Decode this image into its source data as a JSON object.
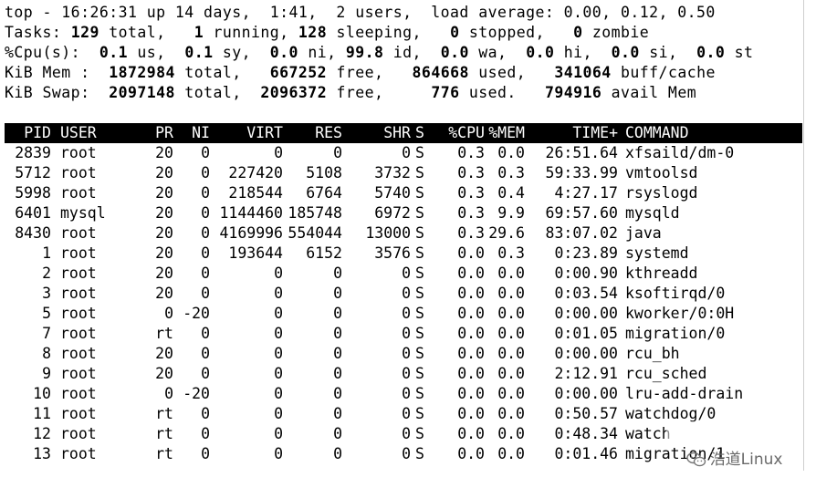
{
  "summary": {
    "line1": "top - 16:26:31 up 14 days,  1:41,  2 users,  load average: 0.00, 0.12, 0.50",
    "tasks": {
      "label": "Tasks: ",
      "total": "129",
      "total_label": " total,   ",
      "running": "1",
      "running_label": " running, ",
      "sleeping": "128",
      "sleeping_label": " sleeping,   ",
      "stopped": "0",
      "stopped_label": " stopped,   ",
      "zombie": "0",
      "zombie_label": " zombie"
    },
    "cpu": {
      "label": "%Cpu(s):  ",
      "us": "0.1",
      "us_label": " us,  ",
      "sy": "0.1",
      "sy_label": " sy,  ",
      "ni": "0.0",
      "ni_label": " ni, ",
      "id": "99.8",
      "id_label": " id,  ",
      "wa": "0.0",
      "wa_label": " wa,  ",
      "hi": "0.0",
      "hi_label": " hi,  ",
      "si": "0.0",
      "si_label": " si,  ",
      "st": "0.0",
      "st_label": " st"
    },
    "mem": {
      "label": "KiB Mem :  ",
      "total": "1872984",
      "total_label": " total,   ",
      "free": "667252",
      "free_label": " free,   ",
      "used": "864668",
      "used_label": " used,   ",
      "buff": "341064",
      "buff_label": " buff/cache"
    },
    "swap": {
      "label": "KiB Swap:  ",
      "total": "2097148",
      "total_label": " total,  ",
      "free": "2096372",
      "free_label": " free,     ",
      "used": "776",
      "used_label": " used.   ",
      "avail": "794916",
      "avail_label": " avail Mem"
    }
  },
  "table": {
    "headers": {
      "pid": "PID",
      "user": "USER",
      "pr": "PR",
      "ni": "NI",
      "virt": "VIRT",
      "res": "RES",
      "shr": "SHR",
      "s": "S",
      "cpu": "%CPU",
      "mem": "%MEM",
      "time": "TIME+",
      "cmd": "COMMAND"
    },
    "rows": [
      {
        "pid": "2839",
        "user": "root",
        "pr": "20",
        "ni": "0",
        "virt": "0",
        "res": "0",
        "shr": "0",
        "s": "S",
        "cpu": "0.3",
        "mem": "0.0",
        "time": "26:51.64",
        "cmd": "xfsaild/dm-0"
      },
      {
        "pid": "5712",
        "user": "root",
        "pr": "20",
        "ni": "0",
        "virt": "227420",
        "res": "5108",
        "shr": "3732",
        "s": "S",
        "cpu": "0.3",
        "mem": "0.3",
        "time": "59:33.99",
        "cmd": "vmtoolsd"
      },
      {
        "pid": "5998",
        "user": "root",
        "pr": "20",
        "ni": "0",
        "virt": "218544",
        "res": "6764",
        "shr": "5740",
        "s": "S",
        "cpu": "0.3",
        "mem": "0.4",
        "time": "4:27.17",
        "cmd": "rsyslogd"
      },
      {
        "pid": "6401",
        "user": "mysql",
        "pr": "20",
        "ni": "0",
        "virt": "1144460",
        "res": "185748",
        "shr": "6972",
        "s": "S",
        "cpu": "0.3",
        "mem": "9.9",
        "time": "69:57.60",
        "cmd": "mysqld"
      },
      {
        "pid": "8430",
        "user": "root",
        "pr": "20",
        "ni": "0",
        "virt": "4169996",
        "res": "554044",
        "shr": "13000",
        "s": "S",
        "cpu": "0.3",
        "mem": "29.6",
        "time": "83:07.02",
        "cmd": "java"
      },
      {
        "pid": "1",
        "user": "root",
        "pr": "20",
        "ni": "0",
        "virt": "193644",
        "res": "6152",
        "shr": "3576",
        "s": "S",
        "cpu": "0.0",
        "mem": "0.3",
        "time": "0:23.89",
        "cmd": "systemd"
      },
      {
        "pid": "2",
        "user": "root",
        "pr": "20",
        "ni": "0",
        "virt": "0",
        "res": "0",
        "shr": "0",
        "s": "S",
        "cpu": "0.0",
        "mem": "0.0",
        "time": "0:00.90",
        "cmd": "kthreadd"
      },
      {
        "pid": "3",
        "user": "root",
        "pr": "20",
        "ni": "0",
        "virt": "0",
        "res": "0",
        "shr": "0",
        "s": "S",
        "cpu": "0.0",
        "mem": "0.0",
        "time": "0:03.54",
        "cmd": "ksoftirqd/0"
      },
      {
        "pid": "5",
        "user": "root",
        "pr": "0",
        "ni": "-20",
        "virt": "0",
        "res": "0",
        "shr": "0",
        "s": "S",
        "cpu": "0.0",
        "mem": "0.0",
        "time": "0:00.00",
        "cmd": "kworker/0:0H"
      },
      {
        "pid": "7",
        "user": "root",
        "pr": "rt",
        "ni": "0",
        "virt": "0",
        "res": "0",
        "shr": "0",
        "s": "S",
        "cpu": "0.0",
        "mem": "0.0",
        "time": "0:01.05",
        "cmd": "migration/0"
      },
      {
        "pid": "8",
        "user": "root",
        "pr": "20",
        "ni": "0",
        "virt": "0",
        "res": "0",
        "shr": "0",
        "s": "S",
        "cpu": "0.0",
        "mem": "0.0",
        "time": "0:00.00",
        "cmd": "rcu_bh"
      },
      {
        "pid": "9",
        "user": "root",
        "pr": "20",
        "ni": "0",
        "virt": "0",
        "res": "0",
        "shr": "0",
        "s": "S",
        "cpu": "0.0",
        "mem": "0.0",
        "time": "2:12.91",
        "cmd": "rcu_sched"
      },
      {
        "pid": "10",
        "user": "root",
        "pr": "0",
        "ni": "-20",
        "virt": "0",
        "res": "0",
        "shr": "0",
        "s": "S",
        "cpu": "0.0",
        "mem": "0.0",
        "time": "0:00.00",
        "cmd": "lru-add-drain"
      },
      {
        "pid": "11",
        "user": "root",
        "pr": "rt",
        "ni": "0",
        "virt": "0",
        "res": "0",
        "shr": "0",
        "s": "S",
        "cpu": "0.0",
        "mem": "0.0",
        "time": "0:50.57",
        "cmd": "watchdog/0"
      },
      {
        "pid": "12",
        "user": "root",
        "pr": "rt",
        "ni": "0",
        "virt": "0",
        "res": "0",
        "shr": "0",
        "s": "S",
        "cpu": "0.0",
        "mem": "0.0",
        "time": "0:48.34",
        "cmd": "watch"
      },
      {
        "pid": "13",
        "user": "root",
        "pr": "rt",
        "ni": "0",
        "virt": "0",
        "res": "0",
        "shr": "0",
        "s": "S",
        "cpu": "0.0",
        "mem": "0.0",
        "time": "0:01.46",
        "cmd": "migration/1"
      }
    ]
  },
  "watermark": {
    "text": "浩道Linux",
    "icon": "wechat-icon",
    "color": "#6a6a6a"
  }
}
